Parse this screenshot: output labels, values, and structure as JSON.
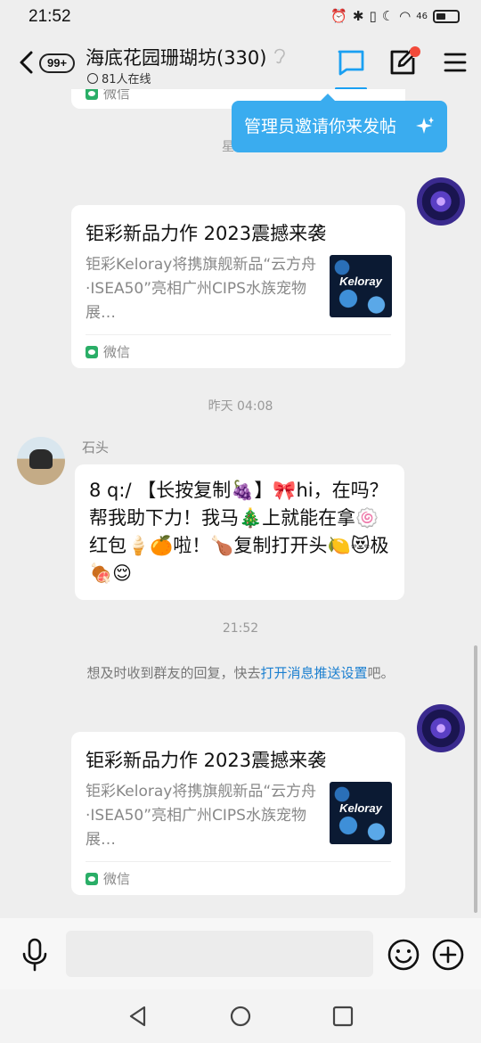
{
  "status_bar": {
    "time": "21:52",
    "signal": "46"
  },
  "header": {
    "unread_badge": "99+",
    "group_name": "海底花园珊瑚坊(330)",
    "online_count": "81人在线"
  },
  "tooltip": {
    "text": "管理员邀请你来发帖"
  },
  "messages": {
    "partial_card_source": "微信",
    "time_1": "星期六",
    "card_1": {
      "title": "钜彩新品力作 2023震撼来袭",
      "desc": "钜彩Keloray将携旗舰新品“云方舟·ISEA50”亮相广州CIPS水族宠物展…",
      "thumb_text": "Keloray",
      "source": "微信"
    },
    "time_2": "昨天 04:08",
    "sender": "石头",
    "text_message": "8 q:/ 【长按复制🍇】🎀hi，在吗？帮我助下力！我马🎄上就能在拿🍥红包🍦🍊啦！🍗复制打开头🍋😻极 🍖😌",
    "time_3": "21:52",
    "notice_prefix": "想及时收到群友的回复，快去",
    "notice_link": "打开消息推送设置",
    "notice_suffix": "吧。",
    "card_2": {
      "title": "钜彩新品力作 2023震撼来袭",
      "desc": "钜彩Keloray将携旗舰新品“云方舟·ISEA50”亮相广州CIPS水族宠物展…",
      "thumb_text": "Keloray",
      "source": "微信"
    }
  },
  "input": {
    "value": ""
  },
  "colors": {
    "accent": "#1aa0f2",
    "tooltip": "#3aacef",
    "alert": "#f24a3a",
    "wechat": "#2aae67"
  }
}
